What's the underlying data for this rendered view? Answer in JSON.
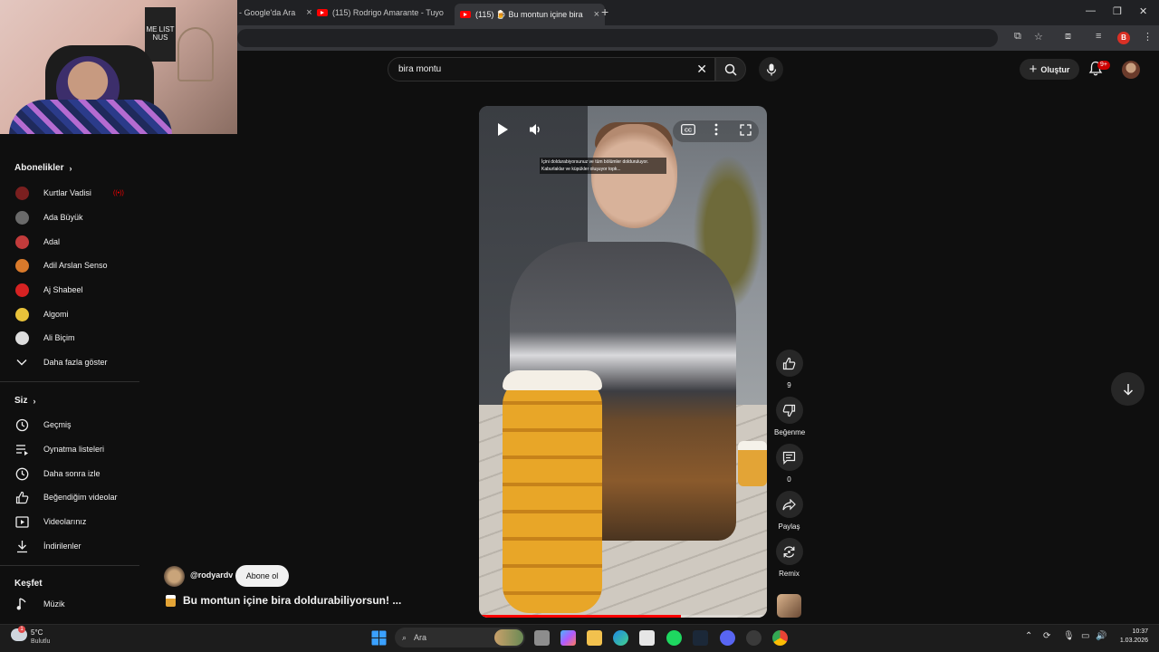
{
  "browser": {
    "tabs": [
      {
        "label": "- Google'da Ara",
        "active": false
      },
      {
        "label": "(115) Rodrigo Amarante - Tuyo",
        "active": false
      },
      {
        "label": "(115) 🍺 Bu montun içine bira",
        "active": true
      }
    ],
    "profile_initial": "B"
  },
  "header": {
    "search_value": "bira montu",
    "create_label": "Oluştur",
    "notification_count": "9+"
  },
  "sidebar": {
    "subscriptions_title": "Abonelikler",
    "subscriptions": [
      {
        "label": "Kurtlar Vadisi",
        "live": "((•))",
        "color": "#7a1f1f"
      },
      {
        "label": "Ada Büyük",
        "color": "#6a6a6a"
      },
      {
        "label": "Adal",
        "color": "#c23b3b"
      },
      {
        "label": "Adil Arslan Senso",
        "color": "#d97a2b"
      },
      {
        "label": "Aj Shabeel",
        "color": "#d62222"
      },
      {
        "label": "Algomi",
        "color": "#e8c23a"
      },
      {
        "label": "Ali Biçim",
        "color": "#dddddd"
      }
    ],
    "show_more": "Daha fazla göster",
    "you_title": "Siz",
    "you_items": [
      {
        "label": "Geçmiş",
        "icon": "history-icon"
      },
      {
        "label": "Oynatma listeleri",
        "icon": "playlists-icon"
      },
      {
        "label": "Daha sonra izle",
        "icon": "watch-later-icon"
      },
      {
        "label": "Beğendiğim videolar",
        "icon": "liked-icon"
      },
      {
        "label": "Videolarınız",
        "icon": "your-videos-icon"
      },
      {
        "label": "İndirilenler",
        "icon": "downloads-icon"
      }
    ],
    "explore_title": "Keşfet",
    "explore_items": [
      {
        "label": "Müzik",
        "icon": "music-icon"
      }
    ]
  },
  "player": {
    "caption": "İçini doldurabiyorsunuz ve tüm bölümler dolduruluyor. Kaburlaklar ve küpükler oluşuyor topk...",
    "progress": 0.7
  },
  "actions": {
    "like_count": "9",
    "dislike_label": "Beğenme",
    "comment_count": "0",
    "share_label": "Paylaş",
    "remix_label": "Remix"
  },
  "short": {
    "channel": "@rodyardv",
    "subscribe_label": "Abone ol",
    "title": "Bu montun içine bira doldurabiliyorsun! ..."
  },
  "taskbar": {
    "temperature": "5°C",
    "weather": "Bulutlu",
    "weather_badge": "1",
    "search_placeholder": "Ara",
    "time": "10:37",
    "date": "1.03.2026"
  },
  "webcam": {
    "poster_text": "ME LIST NUS"
  }
}
